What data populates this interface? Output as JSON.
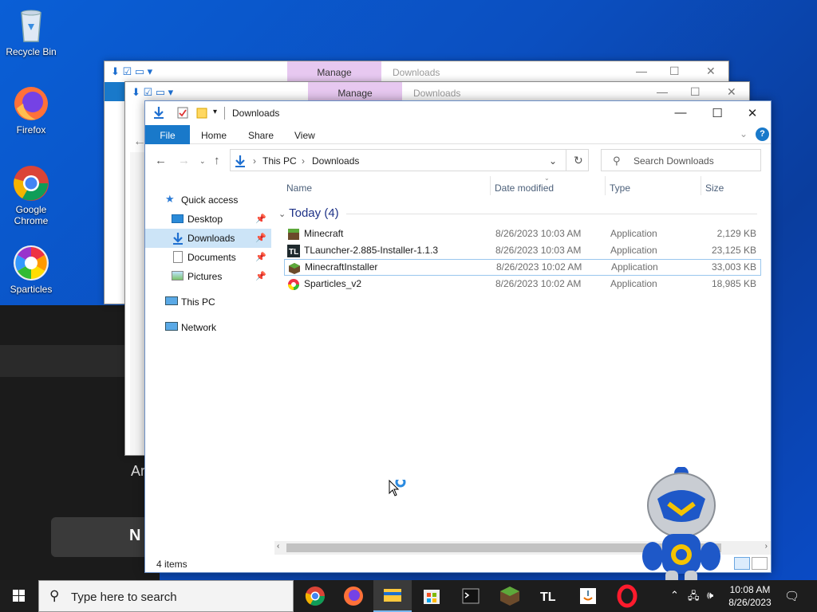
{
  "desktop": {
    "icons": [
      {
        "label": "Recycle Bin"
      },
      {
        "label": "Firefox"
      },
      {
        "label": "Google Chrome"
      },
      {
        "label": "Sparticles"
      }
    ],
    "dark_app": {
      "partial_text": "Ar",
      "button_text": "N"
    }
  },
  "bg_windows": [
    {
      "manage": "Manage",
      "title": "Downloads"
    },
    {
      "manage": "Manage",
      "title": "Downloads"
    }
  ],
  "explorer": {
    "title": "Downloads",
    "ribbon_tabs": [
      "File",
      "Home",
      "Share",
      "View"
    ],
    "address": {
      "root": "This PC",
      "current": "Downloads"
    },
    "search_placeholder": "Search Downloads",
    "nav": {
      "quick_access": "Quick access",
      "items": [
        {
          "label": "Desktop",
          "pinned": true
        },
        {
          "label": "Downloads",
          "pinned": true,
          "selected": true
        },
        {
          "label": "Documents",
          "pinned": true
        },
        {
          "label": "Pictures",
          "pinned": true
        }
      ],
      "this_pc": "This PC",
      "network": "Network"
    },
    "columns": {
      "name": "Name",
      "date": "Date modified",
      "type": "Type",
      "size": "Size"
    },
    "group": "Today (4)",
    "files": [
      {
        "name": "Minecraft",
        "date": "8/26/2023 10:03 AM",
        "type": "Application",
        "size": "2,129 KB",
        "icon": "minecraft-grass-icon"
      },
      {
        "name": "TLauncher-2.885-Installer-1.1.3",
        "date": "8/26/2023 10:03 AM",
        "type": "Application",
        "size": "23,125 KB",
        "icon": "tlauncher-icon"
      },
      {
        "name": "MinecraftInstaller",
        "date": "8/26/2023 10:02 AM",
        "type": "Application",
        "size": "33,003 KB",
        "icon": "minecraft-block-icon"
      },
      {
        "name": "Sparticles_v2",
        "date": "8/26/2023 10:02 AM",
        "type": "Application",
        "size": "18,985 KB",
        "icon": "sparticles-icon"
      }
    ],
    "status": "4 items"
  },
  "taskbar": {
    "search_placeholder": "Type here to search",
    "time": "10:08 AM",
    "date": "8/26/2023",
    "apps": [
      "chrome-icon",
      "firefox-icon",
      "file-explorer-icon",
      "store-icon",
      "terminal-icon",
      "minecraft-icon",
      "tlauncher-icon",
      "java-icon",
      "opera-icon"
    ]
  },
  "colors": {
    "accent": "#1979ca",
    "manage_tab": "#e7c8f0",
    "selected_nav": "#cce4f7"
  }
}
